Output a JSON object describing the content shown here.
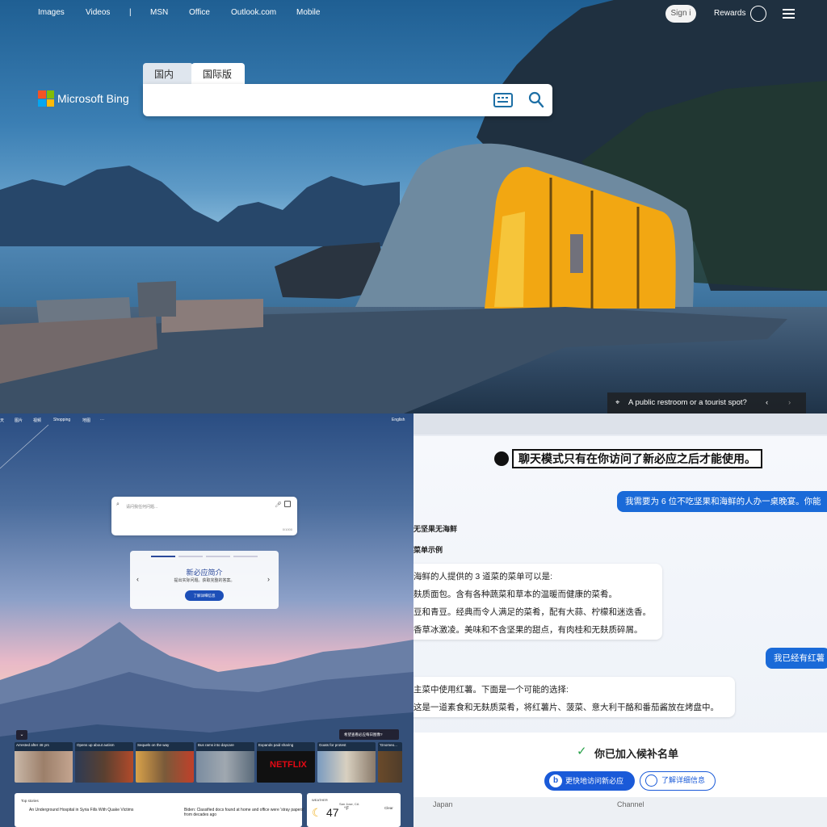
{
  "top": {
    "nav": [
      "Images",
      "Videos",
      "|",
      "MSN",
      "Office",
      "Outlook.com",
      "Mobile"
    ],
    "signin": "Sign i",
    "rewards": "Rewards",
    "logo": "Microsoft Bing",
    "tabs": [
      "国内版",
      "国际版"
    ],
    "caption": "A public restroom or a tourist spot?"
  },
  "bl": {
    "nav": [
      "天",
      "图片",
      "视频",
      "Shopping",
      "地图",
      "···"
    ],
    "lang": "English",
    "search_placeholder": "请问我任何问题...",
    "search_count": "0/1000",
    "card_title": "新必应简介",
    "card_sub": "提出实际问题。获取完整的答案。",
    "card_btn": "了解详细信息",
    "feedback": "希望查看必应每日图像?",
    "news": [
      "Arrested after 46 yrs",
      "Opens up about autism",
      "Sequels on the way",
      "Bus rams into daycare",
      "Expands paid sharing",
      "Goats for protest",
      "'Gnomeo..."
    ],
    "top_stories": "Top stories",
    "story1": "An Underground Hospital in Syria Fills With Quake Victims",
    "story2": "Biden: Classified docs found at home and office were 'stray papers' from decades ago",
    "weather_label": "WEATHER",
    "weather_loc": "San Jose, CA",
    "weather_temp": "47",
    "weather_unit": "°F",
    "weather_cond": "Clear"
  },
  "br": {
    "title": "聊天模式只有在你访问了新必应之后才能使用。",
    "user_msg1": "我需要为 6 位不吃坚果和海鲜的人办一桌晚宴。你能",
    "bot_heading1": "无坚果无海鲜",
    "bot_heading2": "菜单示例",
    "bot_lines": [
      "海鲜的人提供的 3 道菜的菜单可以是:",
      "麸质面包。含有各种蔬菜和草本的温暖而健康的菜肴。",
      "豆和青豆。经典而令人满足的菜肴，配有大蒜、柠檬和迷迭香。",
      "香草冰激凌。美味和不含坚果的甜点，有肉桂和无麸质碎屑。"
    ],
    "user_msg2": "我已经有红薯",
    "bot_lines2": [
      "主菜中使用红薯。下面是一个可能的选择:",
      "这是一道素食和无麸质菜肴，将红薯片、菠菜、意大利干酪和番茄酱放在烤盘中。"
    ],
    "waitlist_check": "✓",
    "waitlist_msg": "你已加入候补名单",
    "btn_primary": "更快地访问新必应",
    "btn_secondary": "了解详细信息",
    "foot": [
      "Japan",
      "Channel"
    ]
  }
}
